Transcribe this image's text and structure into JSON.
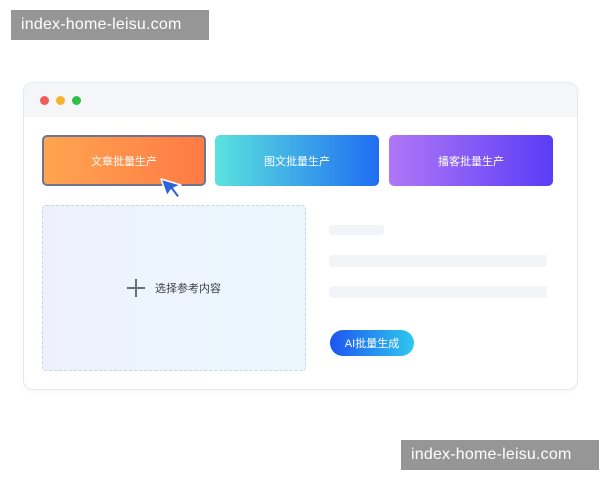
{
  "watermark": {
    "text": "index-home-leisu.com"
  },
  "tabs": {
    "article": "文章批量生产",
    "image_text": "图文批量生产",
    "podcast": "播客批量生产"
  },
  "upload": {
    "label": "选择参考内容"
  },
  "generate_button": {
    "label": "AI批量生成"
  },
  "colors": {
    "article_gradient": [
      "#ffa54f",
      "#ff7a45"
    ],
    "image_text_gradient": [
      "#5be3de",
      "#1f6df2"
    ],
    "podcast_gradient": [
      "#b077f6",
      "#5a3df7"
    ],
    "button_gradient": [
      "#1d55f0",
      "#2fc8ef"
    ]
  }
}
